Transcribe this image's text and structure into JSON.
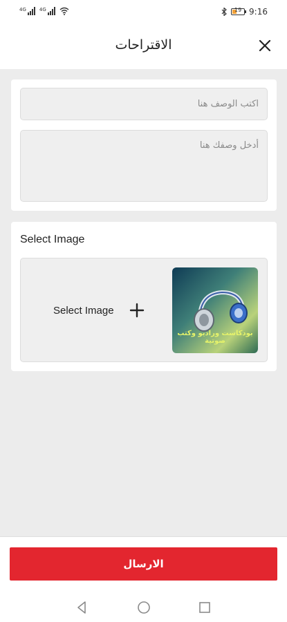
{
  "status_bar": {
    "signal1_label": "4G",
    "signal2_label": "4G",
    "battery_level": "19",
    "time": "9:16",
    "icons": [
      "signal-icon",
      "wifi-icon",
      "bluetooth-icon",
      "battery-icon"
    ]
  },
  "header": {
    "title": "الاقتراحات",
    "close_icon": "close-icon"
  },
  "form": {
    "description_placeholder": "اكتب الوصف هنا",
    "details_placeholder": "أدخل وصفك هنا"
  },
  "image_section": {
    "label": "Select Image",
    "picker_label": "Select Image",
    "plus_icon": "plus-icon",
    "thumbnail_text": "بودكاست وراديو وكتب صوتية"
  },
  "actions": {
    "send_label": "الارسال"
  },
  "colors": {
    "accent": "#e3262f",
    "background": "#ececec"
  },
  "nav_bar": [
    "back-icon",
    "home-icon",
    "recents-icon"
  ]
}
